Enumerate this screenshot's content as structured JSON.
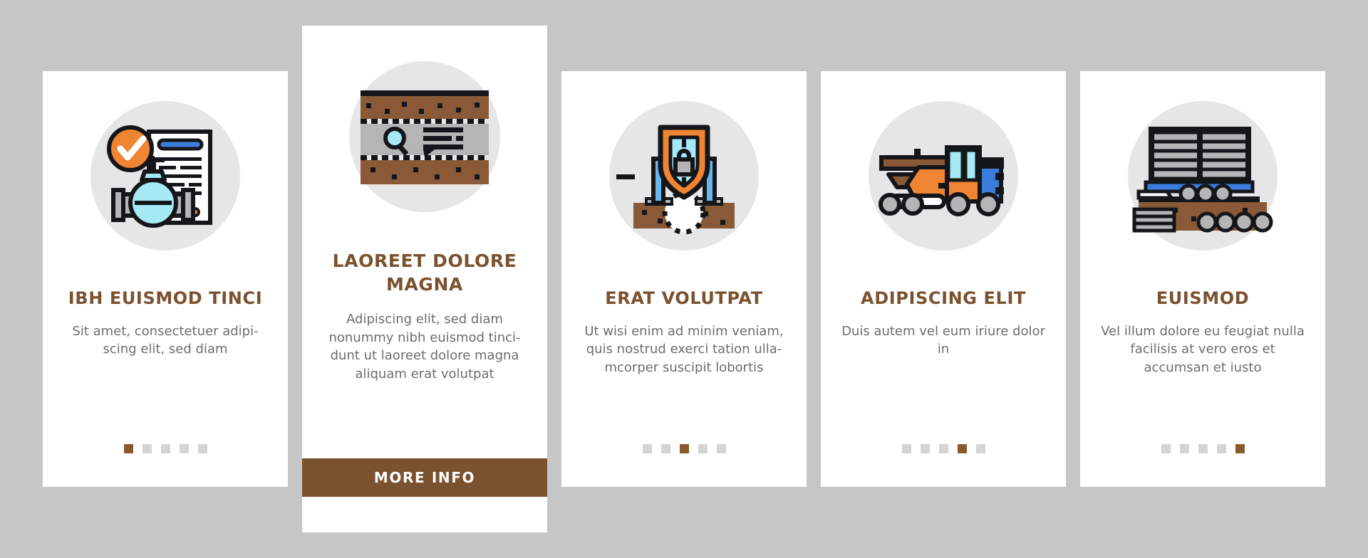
{
  "theme": {
    "page_background": "#c6c6c6",
    "card_background": "#ffffff",
    "icon_circle": "#e6e6e6",
    "title_color": "#7b5230",
    "body_color": "#6d6d6d",
    "accent_brown": "#7b5230",
    "dot_active": "#8a5a2b",
    "dot_inactive": "#d4d4d4",
    "accent_orange": "#ef8432",
    "accent_cyan": "#a5e9f5",
    "accent_blue": "#3b7ddd",
    "accent_soil": "#8a5a38",
    "accent_gray": "#b5b5b5"
  },
  "cards": [
    {
      "id": "card-1",
      "featured": false,
      "icon": "valve-document-approved-icon",
      "title": "IBH EUISMOD TINCI",
      "body": "Sit amet, consectetuer adipi-scing elit, sed diam",
      "dots": {
        "count": 5,
        "active_index": 0
      }
    },
    {
      "id": "card-2",
      "featured": true,
      "icon": "soil-layer-inspection-icon",
      "title": "LAOREET DOLORE MAGNA",
      "body": "Adipiscing elit, sed diam nonummy nibh euismod tinci-dunt ut laoreet dolore magna aliquam erat volutpat",
      "button_label": "MORE INFO"
    },
    {
      "id": "card-3",
      "featured": false,
      "icon": "shield-lock-excavation-icon",
      "title": "ERAT VOLUTPAT",
      "body": "Ut wisi enim ad minim veniam, quis nostrud exerci tation ulla-mcorper suscipit lobortis",
      "dots": {
        "count": 5,
        "active_index": 2
      }
    },
    {
      "id": "card-4",
      "featured": false,
      "icon": "road-grader-vehicle-icon",
      "title": "ADIPISCING ELIT",
      "body": "Duis autem vel eum iriure dolor in",
      "dots": {
        "count": 5,
        "active_index": 3
      }
    },
    {
      "id": "card-5",
      "featured": false,
      "icon": "pipe-transport-truck-icon",
      "title": "EUISMOD",
      "body": "Vel illum dolore eu feugiat nulla facilisis at vero eros et accumsan et iusto",
      "dots": {
        "count": 5,
        "active_index": 4
      }
    }
  ]
}
